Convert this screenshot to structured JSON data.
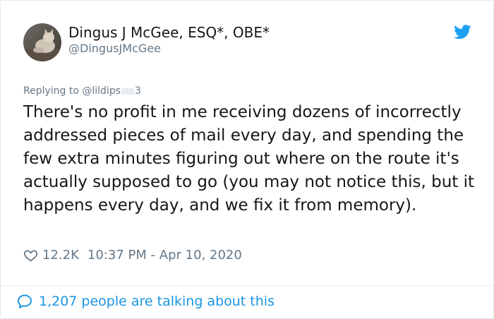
{
  "author": {
    "display_name": "Dingus J McGee, ESQ*, OBE*",
    "handle": "@DingusJMcGee",
    "avatar_icon": "cat-photo-avatar"
  },
  "reply": {
    "prefix": "Replying to ",
    "handle_start": "@lildips",
    "handle_end": "3"
  },
  "tweet": {
    "text": "There's no profit in me receiving dozens of incorrectly addressed pieces of mail every day, and spending the few extra minutes figuring out where on the route it's actually supposed to go (you may not notice this, but it happens every day, and we fix it from memory)."
  },
  "meta": {
    "likes": "12.2K",
    "timestamp": "10:37 PM - Apr 10, 2020"
  },
  "footer": {
    "conversation_text": "1,207 people are talking about this"
  },
  "colors": {
    "twitter_blue": "#1da1f2",
    "link_blue": "#1b95e0",
    "muted_gray": "#657786",
    "text_dark": "#14171a"
  },
  "icons": [
    "twitter-bird-icon",
    "heart-icon",
    "speech-bubble-icon"
  ]
}
